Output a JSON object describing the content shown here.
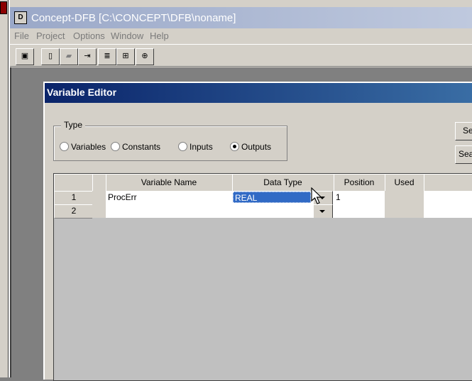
{
  "app": {
    "icon": "D",
    "title": "Concept-DFB [C:\\CONCEPT\\DFB\\noname]",
    "menu": [
      "File",
      "Project",
      "Options",
      "Window",
      "Help"
    ]
  },
  "toolbar": {
    "buttons": [
      {
        "name": "save-exit-icon",
        "glyph": "▣"
      },
      {
        "name": "new-icon",
        "glyph": "▯"
      },
      {
        "name": "open-icon",
        "glyph": "▰"
      },
      {
        "name": "import-icon",
        "glyph": "⇥"
      },
      {
        "name": "properties-icon",
        "glyph": "≣"
      },
      {
        "name": "tree-icon",
        "glyph": "⊞"
      },
      {
        "name": "find-icon",
        "glyph": "⊕"
      }
    ]
  },
  "dialog": {
    "title": "Variable Editor",
    "type_label": "Type",
    "radios": [
      {
        "label": "Variables",
        "selected": false
      },
      {
        "label": "Constants",
        "selected": false
      },
      {
        "label": "Inputs",
        "selected": false
      },
      {
        "label": "Outputs",
        "selected": true
      }
    ],
    "side_buttons": [
      "Se",
      "Sea"
    ],
    "columns": [
      "Variable Name",
      "Data Type",
      "Position",
      "Used"
    ],
    "rows": [
      {
        "num": "1",
        "name": "ProcErr",
        "type": "REAL",
        "position": "1",
        "used": ""
      },
      {
        "num": "2",
        "name": "",
        "type": "",
        "position": "",
        "used": ""
      }
    ]
  },
  "colors": {
    "dialog_title_start": "#0a246a",
    "dialog_title_end": "#3a6ea5",
    "selection": "#316ac5",
    "window_face": "#d4d0c8"
  }
}
